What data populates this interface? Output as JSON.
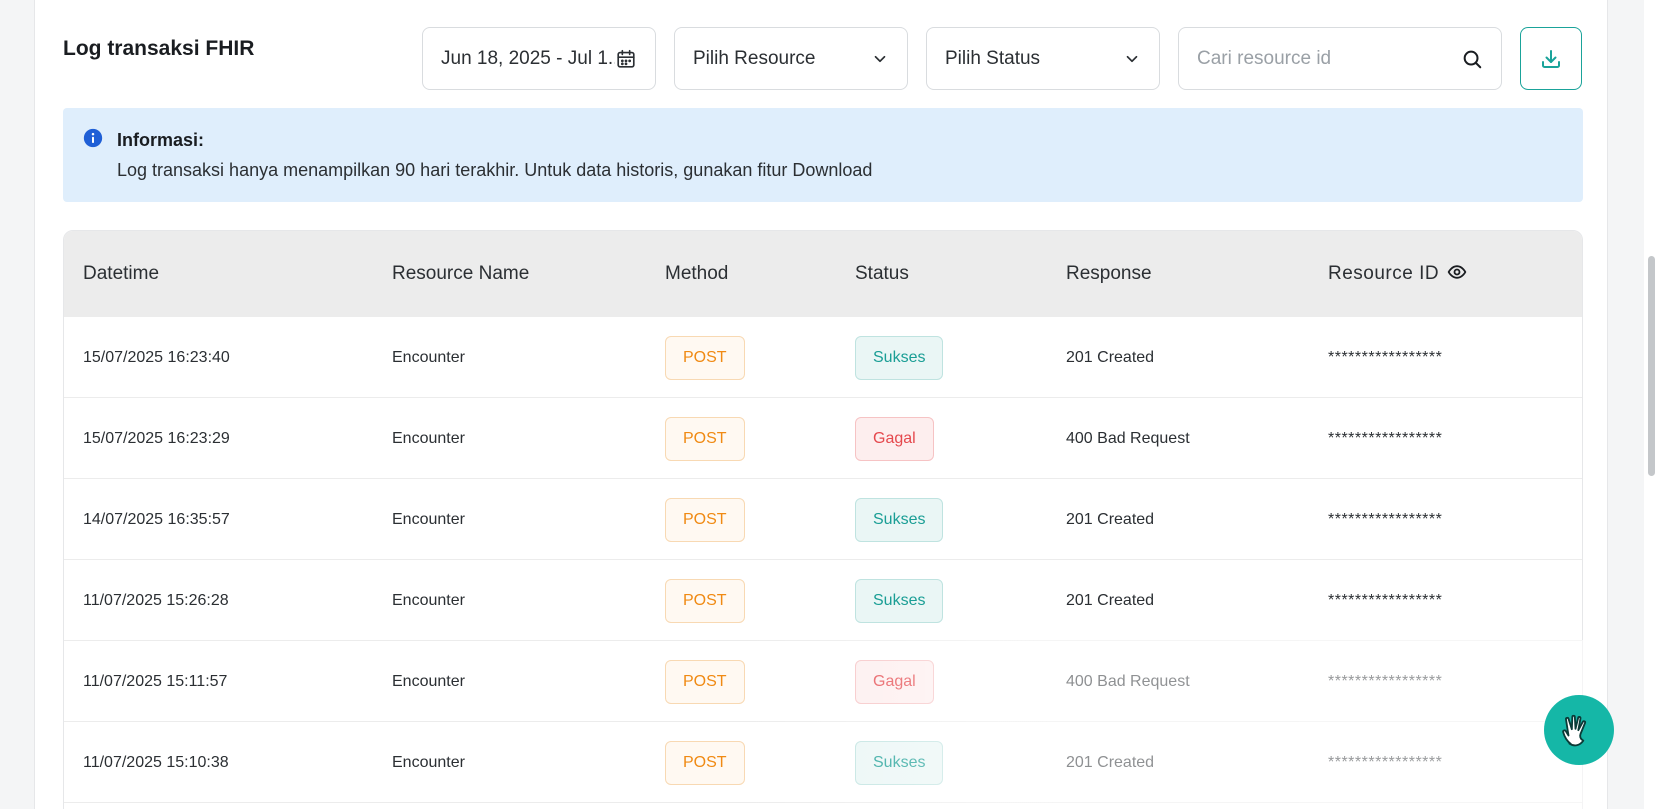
{
  "page": {
    "title": "Log transaksi FHIR"
  },
  "filters": {
    "date_range": "Jun 18, 2025 - Jul 1...",
    "resource_select": "Pilih Resource",
    "status_select": "Pilih Status",
    "search_placeholder": "Cari resource id"
  },
  "info": {
    "title": "Informasi:",
    "text": "Log transaksi hanya menampilkan 90 hari terakhir. Untuk data historis, gunakan fitur Download"
  },
  "table": {
    "columns": [
      "Datetime",
      "Resource Name",
      "Method",
      "Status",
      "Response",
      "Resource ID"
    ],
    "rows": [
      {
        "datetime": "15/07/2025 16:23:40",
        "resource": "Encounter",
        "method": "POST",
        "status": "Sukses",
        "response": "201 Created",
        "resource_id": "*****************"
      },
      {
        "datetime": "15/07/2025 16:23:29",
        "resource": "Encounter",
        "method": "POST",
        "status": "Gagal",
        "response": "400 Bad Request",
        "resource_id": "*****************"
      },
      {
        "datetime": "14/07/2025 16:35:57",
        "resource": "Encounter",
        "method": "POST",
        "status": "Sukses",
        "response": "201 Created",
        "resource_id": "*****************"
      },
      {
        "datetime": "11/07/2025 15:26:28",
        "resource": "Encounter",
        "method": "POST",
        "status": "Sukses",
        "response": "201 Created",
        "resource_id": "*****************"
      },
      {
        "datetime": "11/07/2025 15:11:57",
        "resource": "Encounter",
        "method": "POST",
        "status": "Gagal",
        "response": "400 Bad Request",
        "resource_id": "*****************"
      },
      {
        "datetime": "11/07/2025 15:10:38",
        "resource": "Encounter",
        "method": "POST",
        "status": "Sukses",
        "response": "201 Created",
        "resource_id": "*****************"
      }
    ]
  },
  "icons": {
    "date": "calendar-icon",
    "dropdown": "chevron-down-icon",
    "search": "search-icon",
    "download": "download-icon",
    "info": "info-icon",
    "reveal": "eye-icon",
    "help": "hand-wave-icon"
  },
  "colors": {
    "accent": "#1aa39a",
    "post": "#f08a13",
    "success": "#1a9e95",
    "fail": "#e5484d",
    "info_bg": "#dfeefc"
  }
}
